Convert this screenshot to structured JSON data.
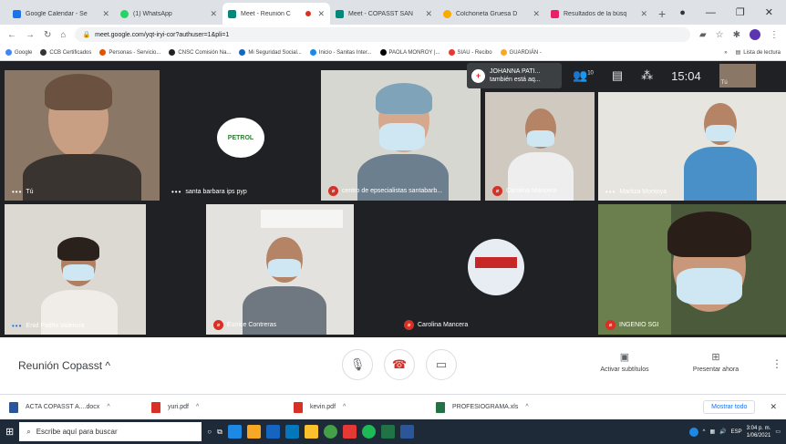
{
  "browser": {
    "tabs": [
      {
        "title": "Google Calendar - Se",
        "color": "#1a73e8"
      },
      {
        "title": "(1) WhatsApp",
        "color": "#25d366"
      },
      {
        "title": "Meet - Reunión C",
        "color": "#00897b"
      },
      {
        "title": "Meet - COPASST SAN",
        "color": "#00897b"
      },
      {
        "title": "Colchoneta Gruesa D",
        "color": "#f9ab00"
      },
      {
        "title": "Resultados de la búsq",
        "color": "#e91e63"
      }
    ],
    "url": "meet.google.com/yqt-iryi-cor?authuser=1&pli=1",
    "bookmarks": [
      "Google",
      "CCB Certificados",
      "Personas - Servicio...",
      "CNSC Comisión Na...",
      "Mi Seguridad Social...",
      "Inicio - Sanitas Inter...",
      "PAOLA MONROY |...",
      "SIAU - Recibo",
      "GUARDIÁN -"
    ],
    "bookmarks_more": "»",
    "reading_list": "Lista de lectura"
  },
  "meet": {
    "notice": {
      "name": "JOHANNA PATI...",
      "text": "también está aq..."
    },
    "participants_count": "10",
    "time": "15:04",
    "self_initials": "Tú",
    "tiles": [
      {
        "name": "Tú"
      },
      {
        "name": "santa barbara ips pyp"
      },
      {
        "name": "centro de epsecialistas santabarb..."
      },
      {
        "name": "Carolina Mancera"
      },
      {
        "name": "Maritza Montoya"
      },
      {
        "name": "Enid Patiño Valencia"
      },
      {
        "name": "Eunice Contreras"
      },
      {
        "name": "Carolina Mancera"
      },
      {
        "name": "INGENIO SGI"
      }
    ],
    "logo_text": "PETROL",
    "meeting_name": "Reunión Copasst",
    "captions_label": "Activar subtítulos",
    "present_label": "Presentar ahora"
  },
  "downloads": [
    {
      "name": "ACTA COPASST A....docx",
      "color": "#2b579a"
    },
    {
      "name": "yuri.pdf",
      "color": "#d93025"
    },
    {
      "name": "kevin.pdf",
      "color": "#d93025"
    },
    {
      "name": "PROFESIOGRAMA.xls",
      "color": "#217346"
    }
  ],
  "show_all": "Mostrar todo",
  "taskbar": {
    "search_placeholder": "Escribe aquí para buscar",
    "lang": "ESP",
    "time": "3:04 p. m.",
    "date": "1/06/2021"
  }
}
